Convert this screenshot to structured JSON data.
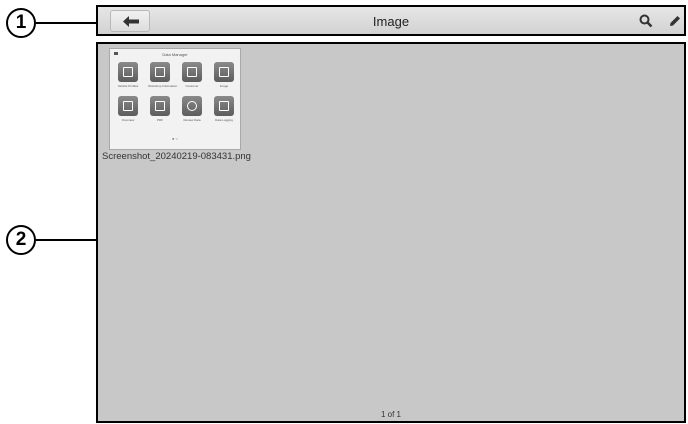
{
  "callouts": {
    "one": "1",
    "two": "2"
  },
  "topbar": {
    "title": "Image",
    "back_icon": "back-arrow-icon",
    "search_icon": "search-icon",
    "edit_icon": "pencil-icon"
  },
  "gallery": {
    "items": [
      {
        "filename": "Screenshot_20240219-083431.png",
        "thumbnail": {
          "title": "Data Manager",
          "tiles": [
            {
              "label": "Vehicle Profiles",
              "icon": "car-icon"
            },
            {
              "label": "Workshop Information",
              "icon": "garage-icon"
            },
            {
              "label": "Customer",
              "icon": "people-icon"
            },
            {
              "label": "Image",
              "icon": "picture-icon"
            },
            {
              "label": "Overview",
              "icon": "clipboard-icon"
            },
            {
              "label": "PDF",
              "icon": "pdf-icon"
            },
            {
              "label": "Review Data",
              "icon": "play-icon"
            },
            {
              "label": "Data Logging",
              "icon": "edit-icon"
            }
          ],
          "pager_dots": "● ○"
        }
      }
    ],
    "pager": "1 of 1"
  },
  "colors": {
    "content_bg": "#c8c8c8",
    "topbar_bg": "#dcdcdc"
  }
}
